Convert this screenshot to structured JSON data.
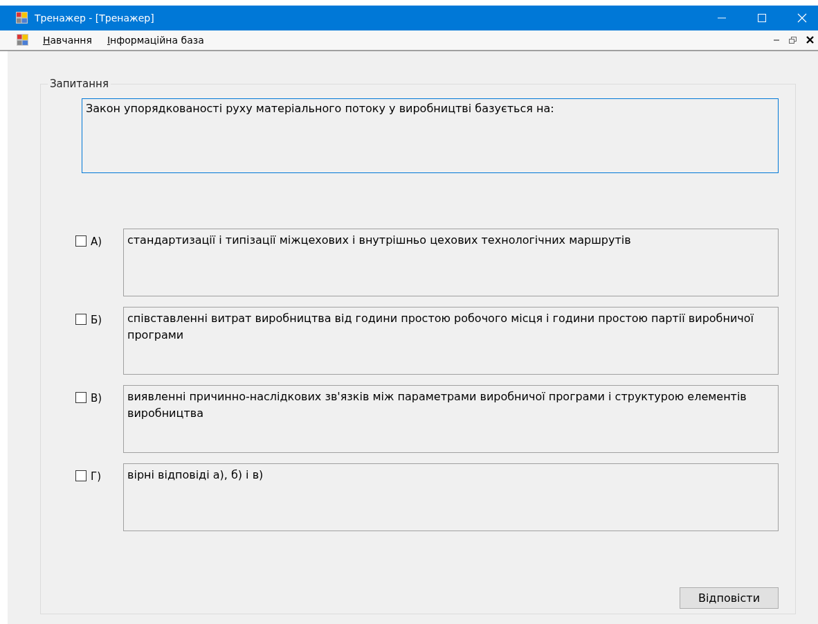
{
  "window": {
    "title": "Тренажер - [Тренажер]"
  },
  "menu": [
    {
      "label": "Навчання"
    },
    {
      "label": "Інформаційна база"
    }
  ],
  "question_group": {
    "legend": "Запитання",
    "question": "Закон упорядкованості руху матеріального потоку у виробництві базується на:"
  },
  "options": [
    {
      "letter": "А)",
      "checked": false,
      "text": "стандартизації і типізації міжцехових і внутрішньо цехових технологічних маршрутів"
    },
    {
      "letter": "Б)",
      "checked": false,
      "text": "співставленні витрат  виробництва від години простою робочого місця і години простою партії виробничої програми"
    },
    {
      "letter": "В)",
      "checked": false,
      "text": "виявленні причинно-наслідкових зв'язків між параметрами виробничої програми і структурою елементів виробництва"
    },
    {
      "letter": "Г)",
      "checked": false,
      "text": "вірні відповіді а), б) і в)"
    }
  ],
  "submit_button": "Відповісти"
}
